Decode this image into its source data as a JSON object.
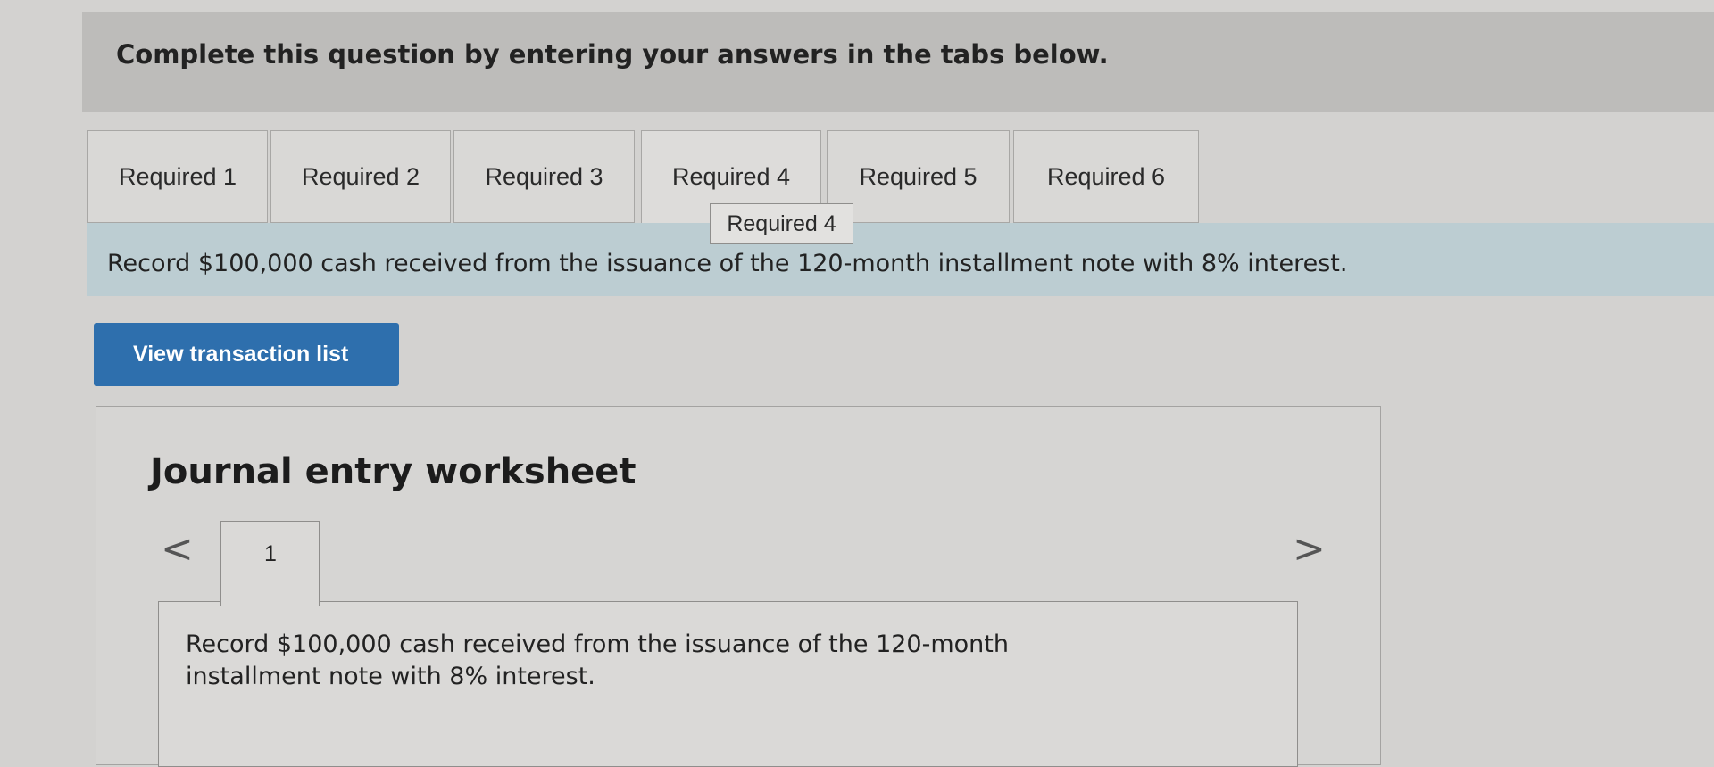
{
  "header": {
    "instruction": "Complete this question by entering your answers in the tabs below."
  },
  "tabs": [
    {
      "label": "Required 1"
    },
    {
      "label": "Required 2"
    },
    {
      "label": "Required 3"
    },
    {
      "label": "Required 4",
      "active": true
    },
    {
      "label": "Required 5"
    },
    {
      "label": "Required 6"
    }
  ],
  "tooltip": "Required 4",
  "requirement_text": "Record $100,000 cash received from the issuance of the 120-month installment note with 8% interest.",
  "view_transaction_button": "View transaction list",
  "worksheet": {
    "title": "Journal entry worksheet",
    "prev_glyph": "<",
    "next_glyph": ">",
    "entry_tab_number": "1",
    "entry_description": "Record $100,000 cash received from the issuance of the 120-month installment note with 8% interest."
  }
}
